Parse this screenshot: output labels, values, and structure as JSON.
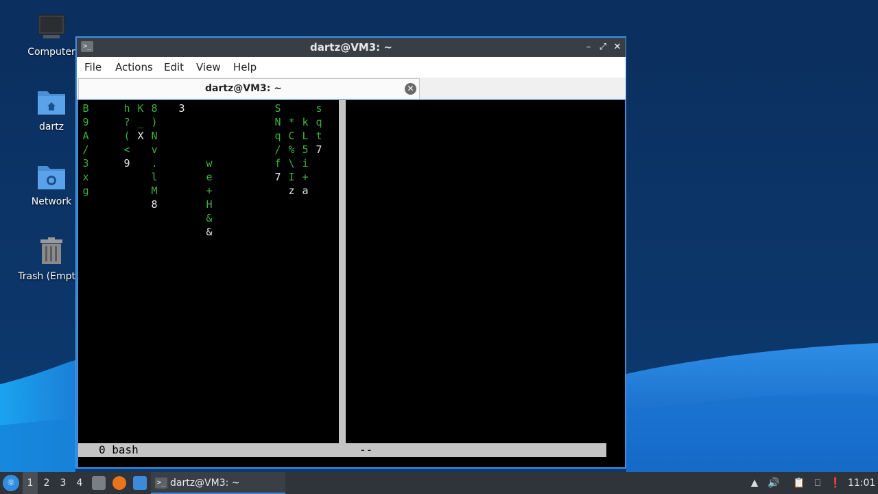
{
  "desktop": {
    "icons": [
      {
        "label": "Computer",
        "icon": "computer-icon"
      },
      {
        "label": "dartz",
        "icon": "home-folder-icon"
      },
      {
        "label": "Network",
        "icon": "network-folder-icon"
      },
      {
        "label": "Trash (Empty)",
        "icon": "trash-icon"
      }
    ]
  },
  "window": {
    "title": "dartz@VM3: ~",
    "controls": {
      "minimize": "–",
      "maximize": "⤢",
      "close": "✕"
    },
    "menu": [
      "File",
      "Actions",
      "Edit",
      "View",
      "Help"
    ],
    "tab": {
      "title": "dartz@VM3: ~",
      "close": "✕"
    },
    "terminal": {
      "status_left": "0 bash",
      "status_right": "--"
    }
  },
  "taskbar": {
    "workspaces": [
      "1",
      "2",
      "3",
      "4"
    ],
    "active_workspace": "1",
    "task_label": "dartz@VM3: ~",
    "clock": "11:01"
  },
  "colors": {
    "matrix_green": "#3cb043",
    "matrix_white": "#e8e8e8",
    "window_border": "#3c8ad9",
    "taskbar": "#2f343b"
  }
}
